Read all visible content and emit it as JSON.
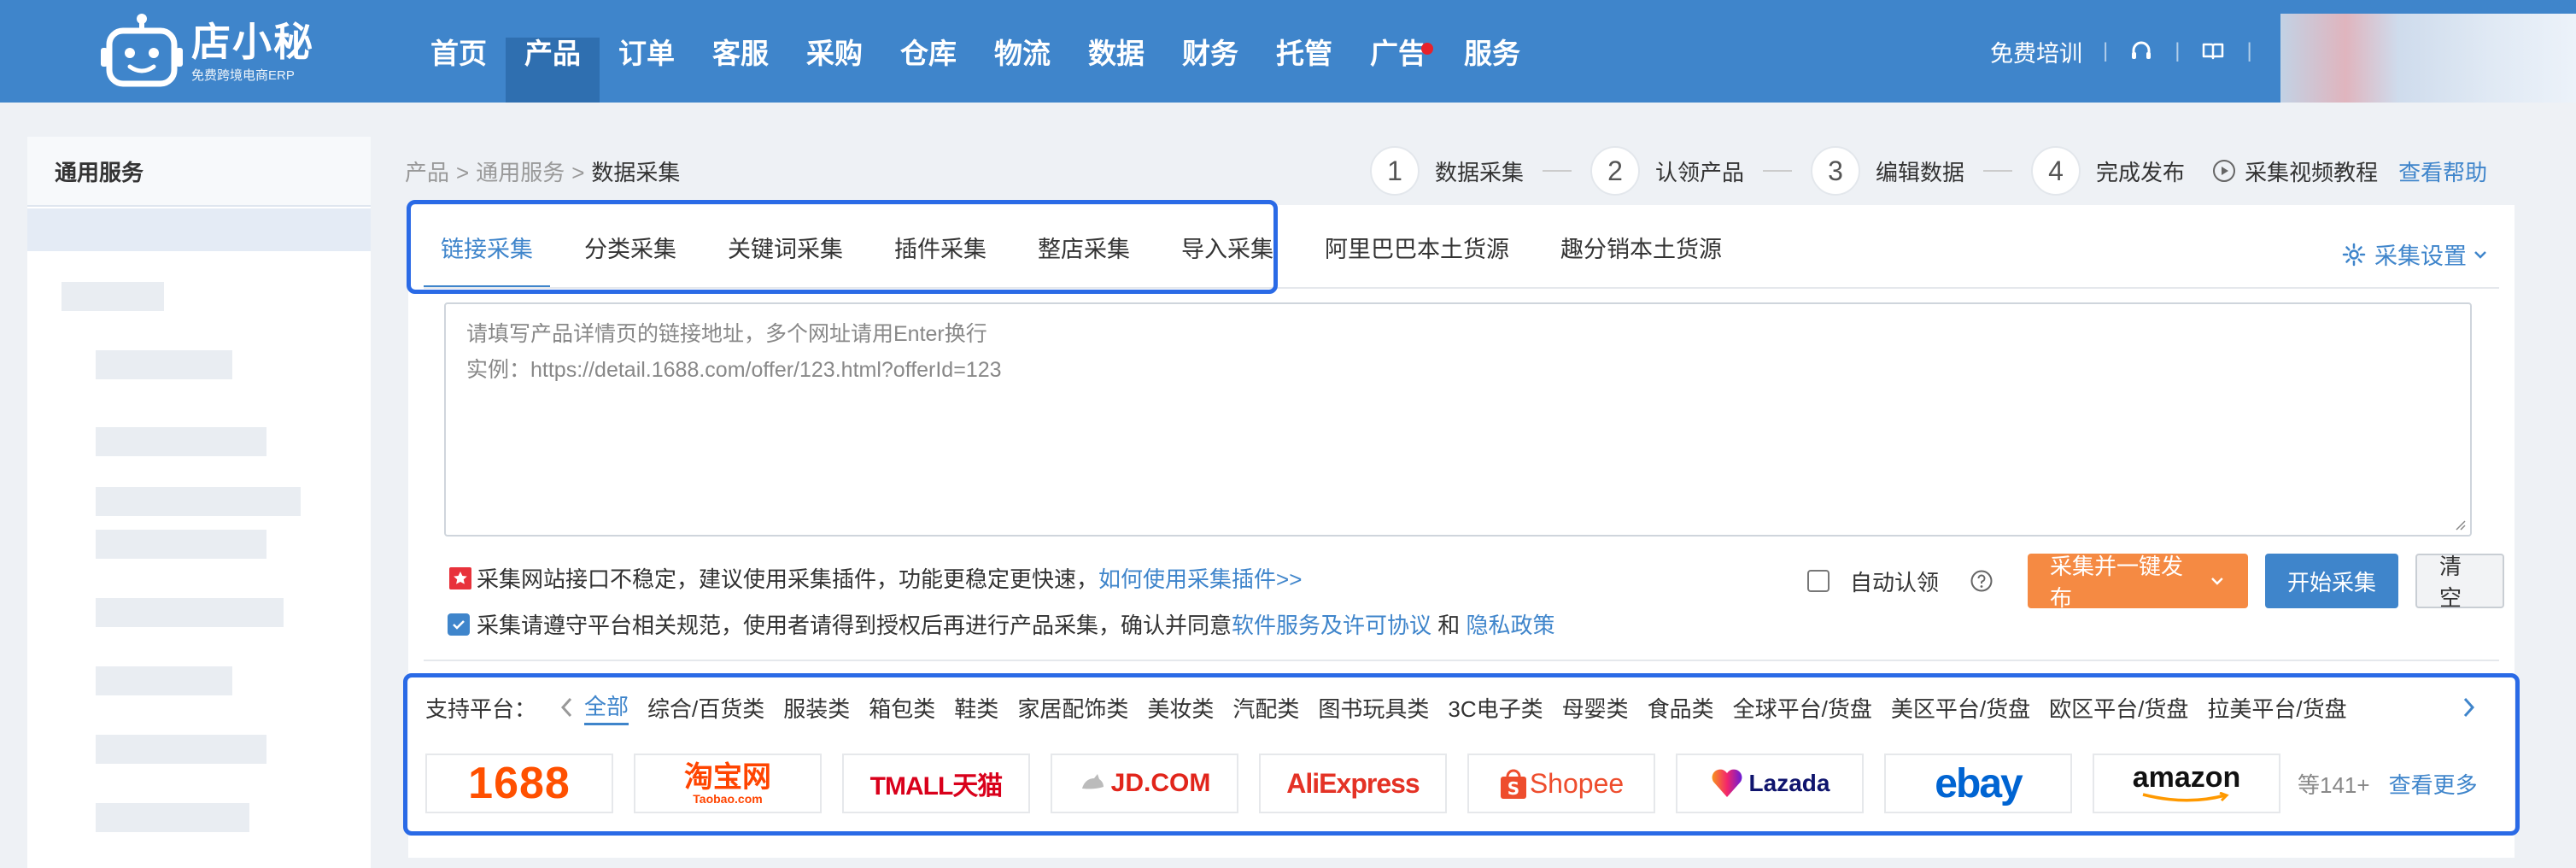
{
  "brand": {
    "name": "店小秘",
    "tagline": "免费跨境电商ERP"
  },
  "nav": {
    "items": [
      {
        "label": "首页"
      },
      {
        "label": "产品"
      },
      {
        "label": "订单"
      },
      {
        "label": "客服"
      },
      {
        "label": "采购"
      },
      {
        "label": "仓库"
      },
      {
        "label": "物流"
      },
      {
        "label": "数据"
      },
      {
        "label": "财务"
      },
      {
        "label": "托管"
      },
      {
        "label": "广告"
      },
      {
        "label": "服务"
      }
    ],
    "active_index": 1,
    "training": "免费培训",
    "separator": "|"
  },
  "sidebar": {
    "title": "通用服务"
  },
  "breadcrumb": {
    "items": [
      "产品",
      "通用服务",
      "数据采集"
    ],
    "sep": ">"
  },
  "steps": {
    "items": [
      {
        "num": "1",
        "label": "数据采集"
      },
      {
        "num": "2",
        "label": "认领产品"
      },
      {
        "num": "3",
        "label": "编辑数据"
      },
      {
        "num": "4",
        "label": "完成发布"
      }
    ],
    "video_tutorial": "采集视频教程",
    "help": "查看帮助"
  },
  "tabs": {
    "items": [
      "链接采集",
      "分类采集",
      "关键词采集",
      "插件采集",
      "整店采集",
      "导入采集",
      "阿里巴巴本土货源",
      "趣分销本土货源"
    ],
    "active_index": 0,
    "settings": "采集设置"
  },
  "url_input": {
    "line1": "请填写产品详情页的链接地址，多个网址请用Enter换行",
    "line2": "实例：https://detail.1688.com/offer/123.html?offerId=123"
  },
  "hints": {
    "warn_text": "采集网站接口不稳定，建议使用采集插件，功能更稳定更快速，",
    "warn_link": "如何使用采集插件>>",
    "agree_text": "采集请遵守平台相关规范，使用者请得到授权后再进行产品采集，确认并同意 ",
    "agree_link1": "软件服务及许可协议",
    "agree_and": " 和 ",
    "agree_link2": "隐私政策"
  },
  "actions": {
    "auto_claim": "自动认领",
    "collect_publish": "采集并一键发布",
    "start": "开始采集",
    "clear": "清空"
  },
  "platforms": {
    "label": "支持平台：",
    "categories": [
      "全部",
      "综合/百货类",
      "服装类",
      "箱包类",
      "鞋类",
      "家居配饰类",
      "美妆类",
      "汽配类",
      "图书玩具类",
      "3C电子类",
      "母婴类",
      "食品类",
      "全球平台/货盘",
      "美区平台/货盘",
      "欧区平台/货盘",
      "拉美平台/货盘"
    ],
    "active_index": 0,
    "logos": [
      {
        "name": "1688",
        "color": "#ff5000"
      },
      {
        "name": "淘宝网",
        "sub": "Taobao.com",
        "color": "#ff4400"
      },
      {
        "name": "TMALL天猫",
        "color": "#d9001b"
      },
      {
        "name": "JD.COM",
        "color": "#e1251b"
      },
      {
        "name": "AliExpress",
        "color": "#e43225"
      },
      {
        "name": "Shopee",
        "color": "#ee4d2d"
      },
      {
        "name": "Lazada",
        "color": "#0f146d"
      },
      {
        "name": "ebay",
        "color": "#0064d2"
      },
      {
        "name": "amazon",
        "color": "#111111"
      }
    ],
    "more_count": "等141+",
    "more_link": "查看更多"
  },
  "colors": {
    "topbar": "#3f85cb",
    "accent": "#3f85cb",
    "orange_button": "#f58a43",
    "highlight": "#2a6ae6"
  }
}
